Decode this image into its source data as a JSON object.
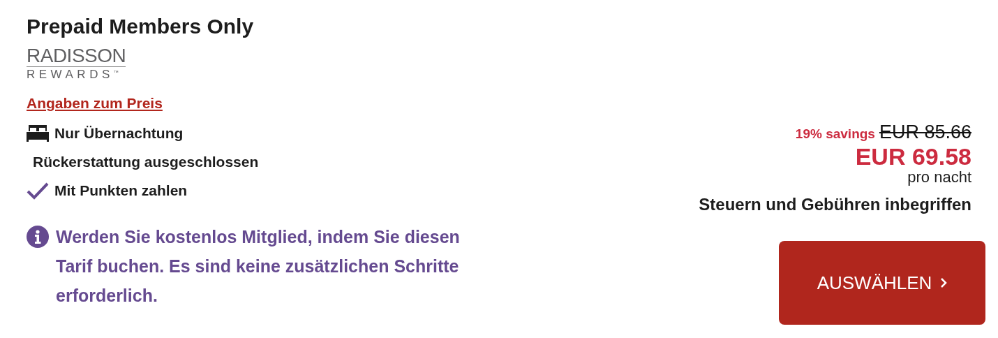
{
  "rate": {
    "title": "Prepaid Members Only",
    "logo": {
      "top": "RADISSON",
      "bottom": "REWARDS",
      "trademark": "™"
    },
    "price_details_link": "Angaben zum Preis",
    "features": [
      {
        "kind": "bed",
        "label": "Nur Übernachtung"
      },
      {
        "kind": "plain",
        "label": "Rückerstattung ausgeschlossen"
      },
      {
        "kind": "check",
        "label": "Mit Punkten zahlen"
      }
    ],
    "info": "Werden Sie kostenlos Mitglied, indem Sie diesen Tarif buchen. Es sind keine zusätzlichen Schritte erforderlich."
  },
  "price": {
    "savings": "19% savings",
    "old_price": "EUR 85.66",
    "new_price": "EUR 69.58",
    "per": "pro nacht",
    "taxes": "Steuern und Gebühren inbegriffen"
  },
  "button": {
    "label": "AUSWÄHLEN"
  }
}
